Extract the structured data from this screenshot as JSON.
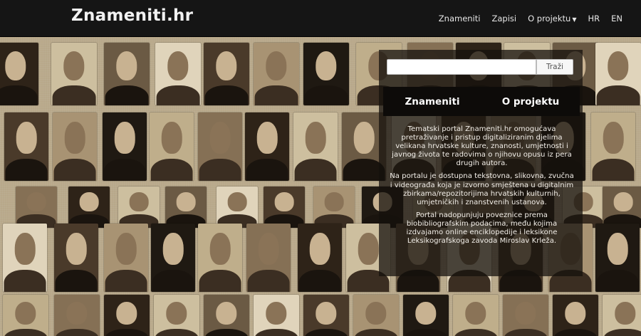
{
  "header": {
    "brand": "Znameniti.hr",
    "nav": {
      "znameniti": "Znameniti",
      "zapisi": "Zapisi",
      "o_projektu": "O projektu",
      "hr": "HR",
      "en": "EN"
    }
  },
  "search": {
    "value": "",
    "button_label": "Traži"
  },
  "tabs": [
    "Znameniti",
    "O projektu"
  ],
  "description": [
    "Tematski portal Znameniti.hr omogućava pretraživanje i pristup digitaliziranim djelima velikana hrvatske kulture, znanosti, umjetnosti i javnog života te radovima o njihovu opusu iz pera drugih autora.",
    "Na portalu je dostupna tekstovna, slikovna, zvučna i videograđa koja je izvorno smještena u digitalnim zbirkama/repozitorijima hrvatskih kulturnih, umjetničkih i znanstvenih ustanova.",
    "Portal nadopunjuju poveznice prema biobibliografskim podacima, među kojima izdvajamo online enciklopedije i leksikone Leksikografskoga zavoda Miroslav Krleža."
  ],
  "colors": {
    "navbar": "#151515",
    "sepia_light": "#c9b897",
    "sepia_dark": "#3a2c20",
    "panel": "#14100c"
  }
}
